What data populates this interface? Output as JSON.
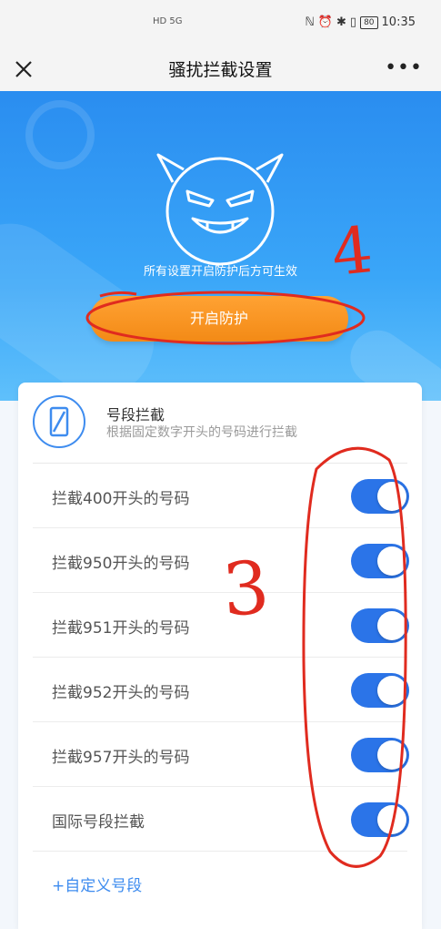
{
  "status_bar": {
    "network": "HD 5G",
    "icons": [
      "nfc-icon",
      "alarm-icon",
      "bluetooth-icon",
      "vibrate-icon"
    ],
    "battery": "80",
    "time": "10:35"
  },
  "navbar": {
    "title": "骚扰拦截设置",
    "more": "•••"
  },
  "hero": {
    "hint": "所有设置开启防护后方可生效",
    "button_label": "开启防护",
    "annotation": "4"
  },
  "card": {
    "title": "号段拦截",
    "subtitle": "根据固定数字开头的号码进行拦截",
    "rows": [
      {
        "label": "拦截400开头的号码",
        "enabled": true
      },
      {
        "label": "拦截950开头的号码",
        "enabled": true
      },
      {
        "label": "拦截951开头的号码",
        "enabled": true
      },
      {
        "label": "拦截952开头的号码",
        "enabled": true
      },
      {
        "label": "拦截957开头的号码",
        "enabled": true
      },
      {
        "label": "国际号段拦截",
        "enabled": true
      }
    ],
    "custom_link": "+自定义号段",
    "annotation": "3"
  },
  "colors": {
    "accent_blue": "#2b74e8",
    "orange": "#f5911d",
    "annotation_red": "#e02b1f"
  }
}
